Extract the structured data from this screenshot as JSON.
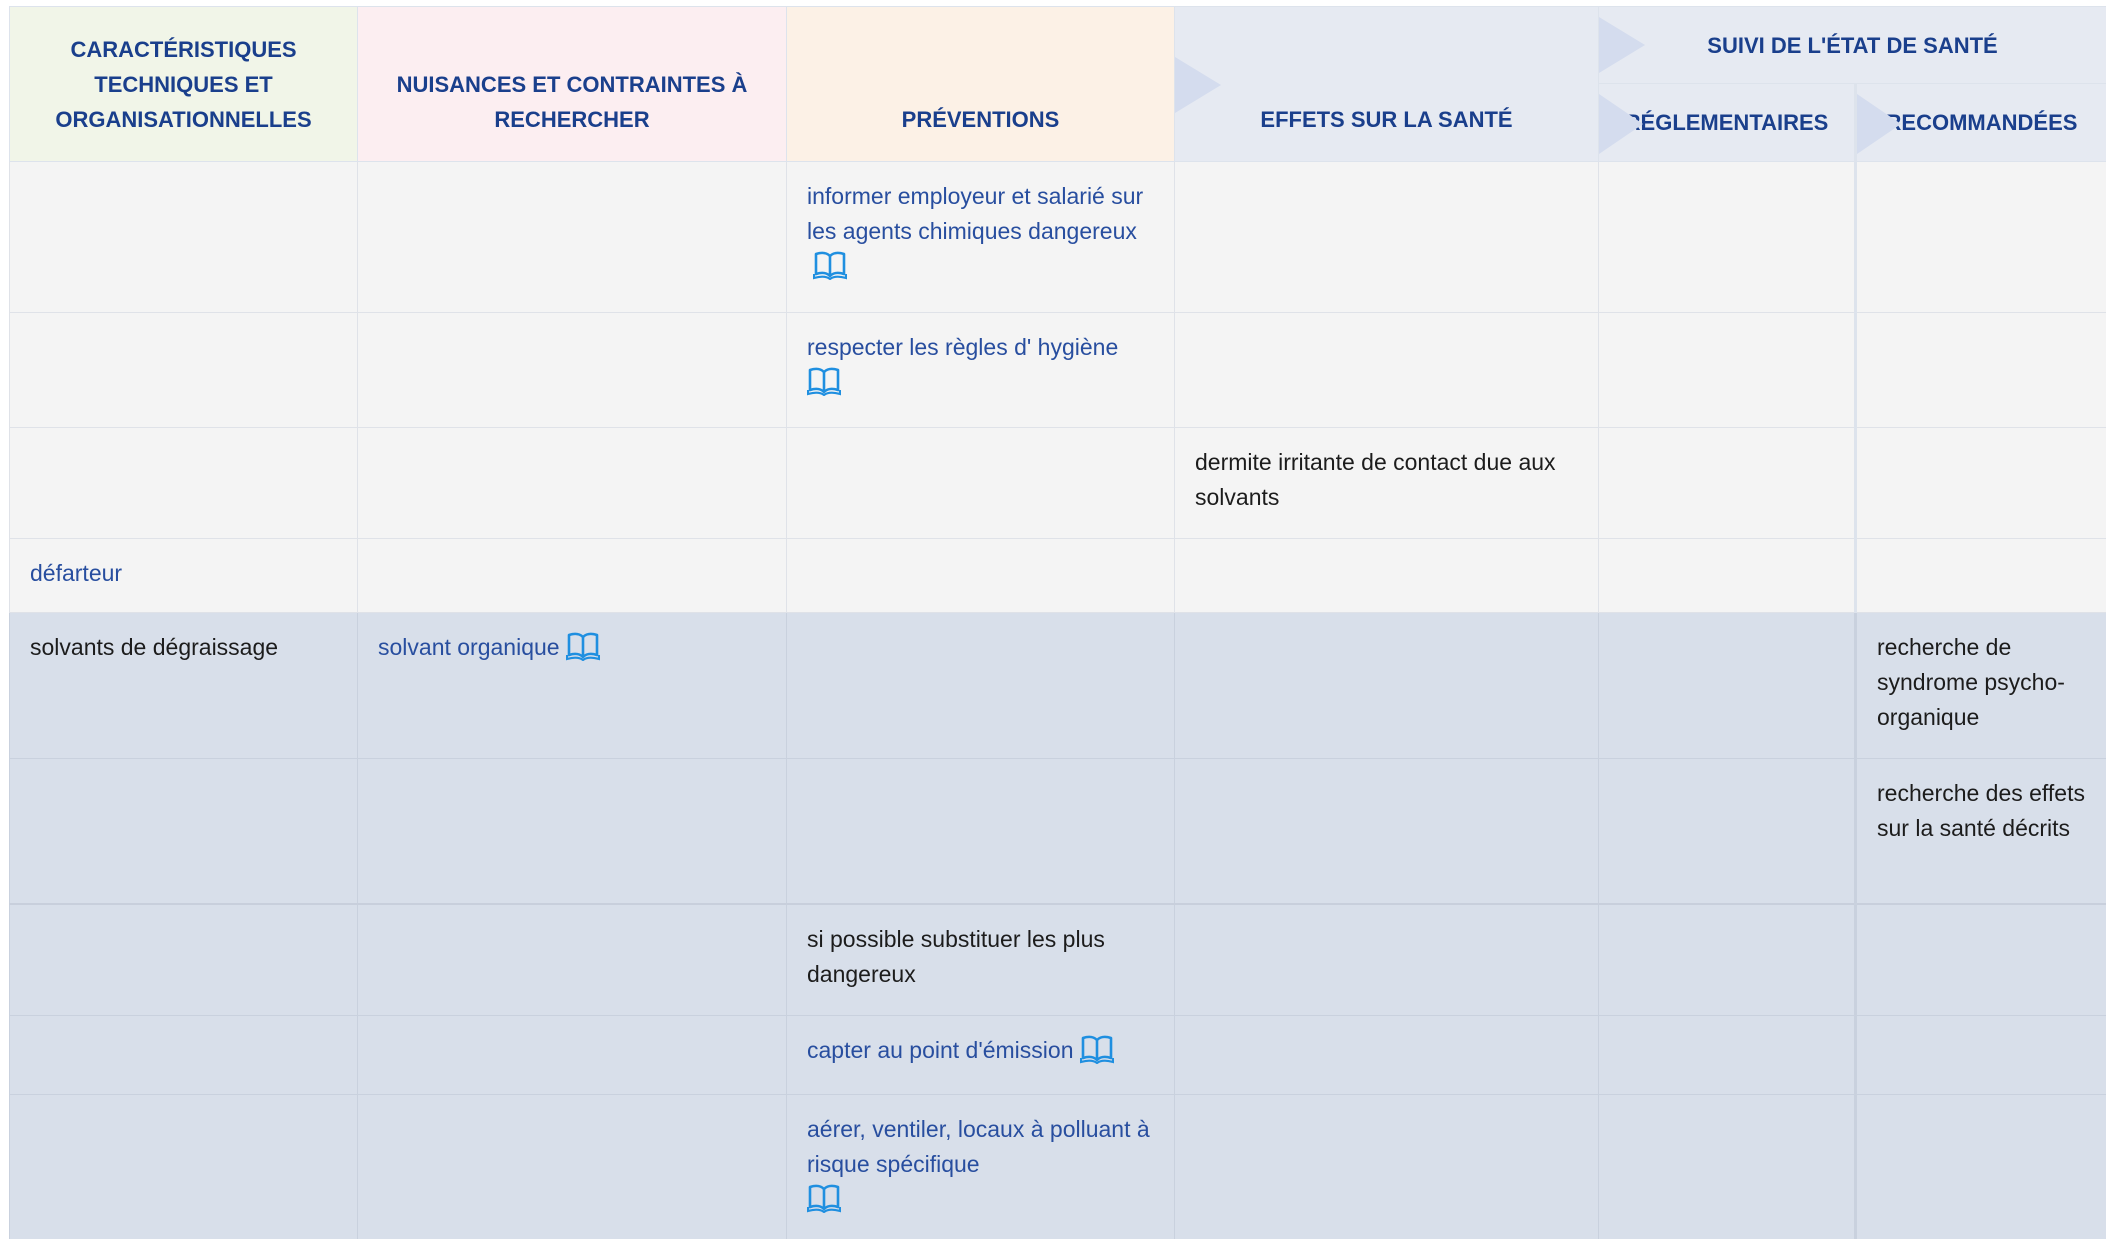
{
  "header": {
    "caracteristiques": "CARACTÉRISTIQUES TECHNIQUES ET ORGANISATIONNELLES",
    "nuisances": "NUISANCES ET CONTRAINTES À RECHERCHER",
    "preventions": "PRÉVENTIONS",
    "effets": "EFFETS SUR LA SANTÉ",
    "suivi": "SUIVI DE L'ÉTAT DE SANTÉ",
    "reglementaires": "RÉGLEMENTAIRES",
    "recommandees": "RECOMMANDÉES"
  },
  "rows": [
    {
      "prevention": "informer employeur et salarié sur les agents chimiques dangereux"
    },
    {
      "prevention": "respecter les règles d' hygiène"
    },
    {
      "effet": "dermite irritante de contact due aux solvants"
    },
    {
      "caracteristique": "défarteur"
    },
    {
      "caracteristique": "solvants de dégraissage",
      "nuisance": "solvant organique",
      "recommandee": "recherche de syndrome psycho-organique"
    },
    {
      "recommandee": "recherche des effets sur la santé décrits"
    },
    {
      "prevention": "si possible substituer les plus dangereux"
    },
    {
      "prevention": "capter au point d'émission"
    },
    {
      "prevention": "aérer, ventiler, locaux à polluant à risque spécifique"
    }
  ],
  "icons": {
    "reference": "open-book-icon"
  },
  "colors": {
    "header_text": "#1a3f8c",
    "link_text": "#284e9f",
    "icon": "#1f8fe0",
    "header_carac_bg": "#f1f5e8",
    "header_nuis_bg": "#fceef1",
    "header_prev_bg": "#fcf1e6",
    "header_sante_bg": "#e6eaf2",
    "group_a_bg": "#f4f4f4",
    "group_b_bg": "#d8dfea"
  }
}
